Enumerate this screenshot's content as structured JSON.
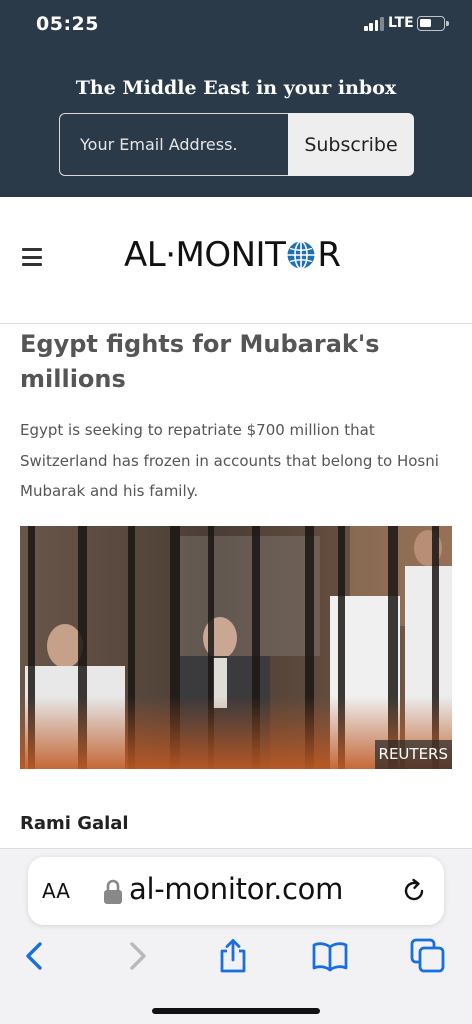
{
  "status_bar": {
    "time": "05:25",
    "network": "LTE",
    "battery_level": 0.45,
    "signal_bars": 3
  },
  "newsletter": {
    "title": "The Middle East in your inbox",
    "email_placeholder": "Your Email Address.",
    "subscribe_label": "Subscribe"
  },
  "site_header": {
    "logo_left": "AL·MONIT",
    "logo_right": "R",
    "menu_icon": "hamburger-menu-icon"
  },
  "article": {
    "headline": "Egypt fights for Mubarak's millions",
    "summary": "Egypt is seeking to repatriate $700 million that Switzerland has frozen in accounts that belong to Hosni Mubarak and his family.",
    "photo_credit": "REUTERS",
    "author": "Rami Galal"
  },
  "browser": {
    "text_size_label": "AA",
    "url": "al-monitor.com",
    "icons": [
      "text-size-icon",
      "lock-icon",
      "reload-icon",
      "back-icon",
      "forward-icon",
      "share-icon",
      "bookmarks-icon",
      "tabs-icon"
    ]
  },
  "colors": {
    "header_bg": "#2a3a49",
    "logo_globe": "#1e6fb5",
    "safari_blue": "#1a6fe0",
    "disabled_gray": "#b8b8bd"
  }
}
